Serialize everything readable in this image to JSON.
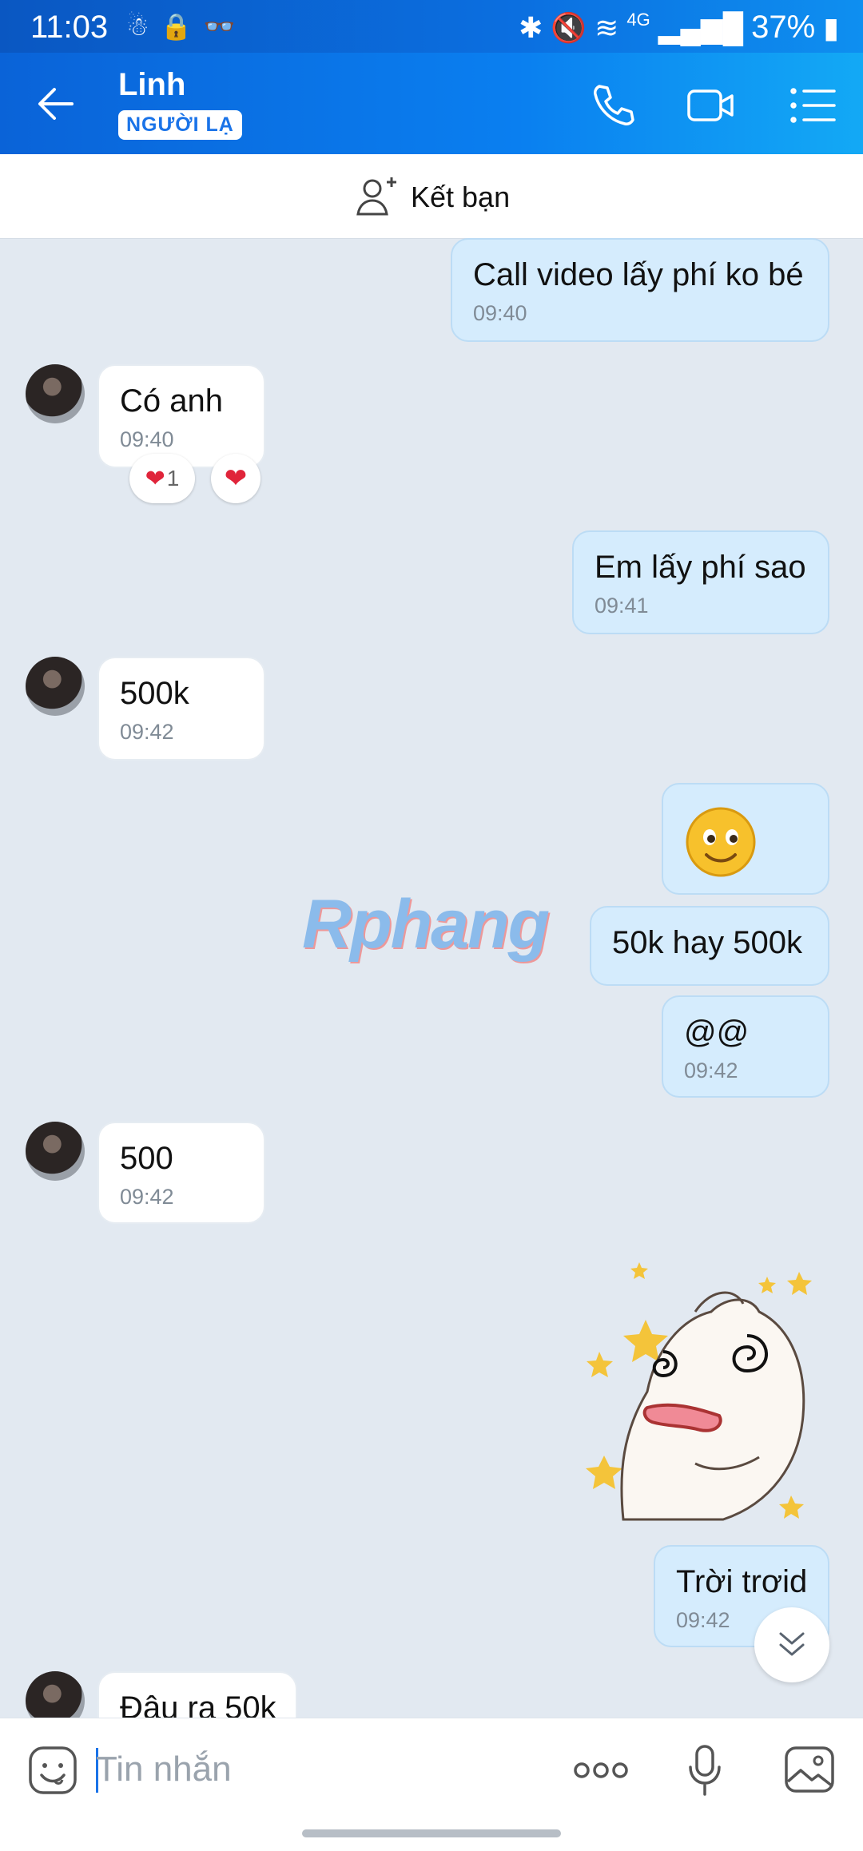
{
  "status_bar": {
    "time": "11:03",
    "battery": "37%",
    "network": "4G"
  },
  "header": {
    "contact_name": "Linh",
    "badge": "NGƯỜI LẠ"
  },
  "add_friend": {
    "label": "Kết bạn"
  },
  "messages": [
    {
      "from": "me",
      "text": "Call video lấy phí ko bé",
      "time": "09:40"
    },
    {
      "from": "other",
      "text": "Có anh",
      "time": "09:40",
      "reaction_count": "1"
    },
    {
      "from": "me",
      "text": "Em lấy phí sao",
      "time": "09:41"
    },
    {
      "from": "other",
      "text": "500k",
      "time": "09:42"
    },
    {
      "from": "me",
      "text": "50k hay 500k"
    },
    {
      "from": "me",
      "text": "@@",
      "time": "09:42"
    },
    {
      "from": "other",
      "text": "500",
      "time": "09:42"
    },
    {
      "from": "me",
      "text": "Trời trơid",
      "time": "09:42"
    },
    {
      "from": "other",
      "text": "Đâu ra 50k"
    }
  ],
  "watermark": "Rphang",
  "composer": {
    "placeholder": "Tin nhắn"
  },
  "colors": {
    "header": "#0a7ff0",
    "my_bubble": "#d5ecfd",
    "background": "#e2e9f1"
  }
}
